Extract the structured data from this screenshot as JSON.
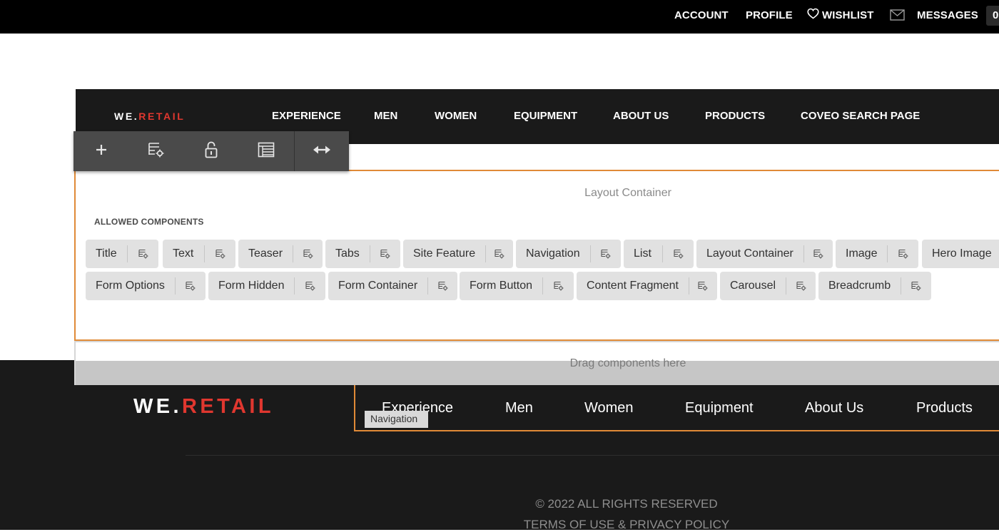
{
  "topbar": {
    "links": [
      "ACCOUNT",
      "PROFILE",
      "WISHLIST",
      "MESSAGES"
    ],
    "message_count": "0"
  },
  "header": {
    "logo_we": "WE.",
    "logo_retail": "RETAIL",
    "nav": [
      "EXPERIENCE",
      "MEN",
      "WOMEN",
      "EQUIPMENT",
      "ABOUT US",
      "PRODUCTS",
      "COVEO SEARCH PAGE"
    ]
  },
  "toolbar": {
    "icons": [
      "plus-icon",
      "policy-icon",
      "unlock-icon",
      "table-icon",
      "resize-horizontal-icon"
    ]
  },
  "layout_container": {
    "title": "Layout Container",
    "allowed_label": "ALLOWED COMPONENTS",
    "row1": [
      "Title",
      "Text",
      "Teaser",
      "Tabs",
      "Site Feature",
      "Navigation",
      "List",
      "Layout Container",
      "Image",
      "Hero Image"
    ],
    "row2": [
      "Form Options",
      "Form Hidden",
      "Form Container",
      "Form Button",
      "Content Fragment",
      "Carousel",
      "Breadcrumb"
    ]
  },
  "drag_text": "Drag components here",
  "footer": {
    "logo_we": "WE.",
    "logo_retail": "RETAIL",
    "nav": [
      "Experience",
      "Men",
      "Women",
      "Equipment",
      "About Us",
      "Products"
    ],
    "nav_tooltip": "Navigation",
    "copyright": "© 2022 ALL RIGHTS RESERVED",
    "terms": "TERMS OF USE & PRIVACY POLICY"
  },
  "colors": {
    "accent_orange": "#e08a37",
    "brand_red": "#e0372f",
    "topbar_bg": "#000000",
    "dark_bg": "#1a1a1a"
  }
}
